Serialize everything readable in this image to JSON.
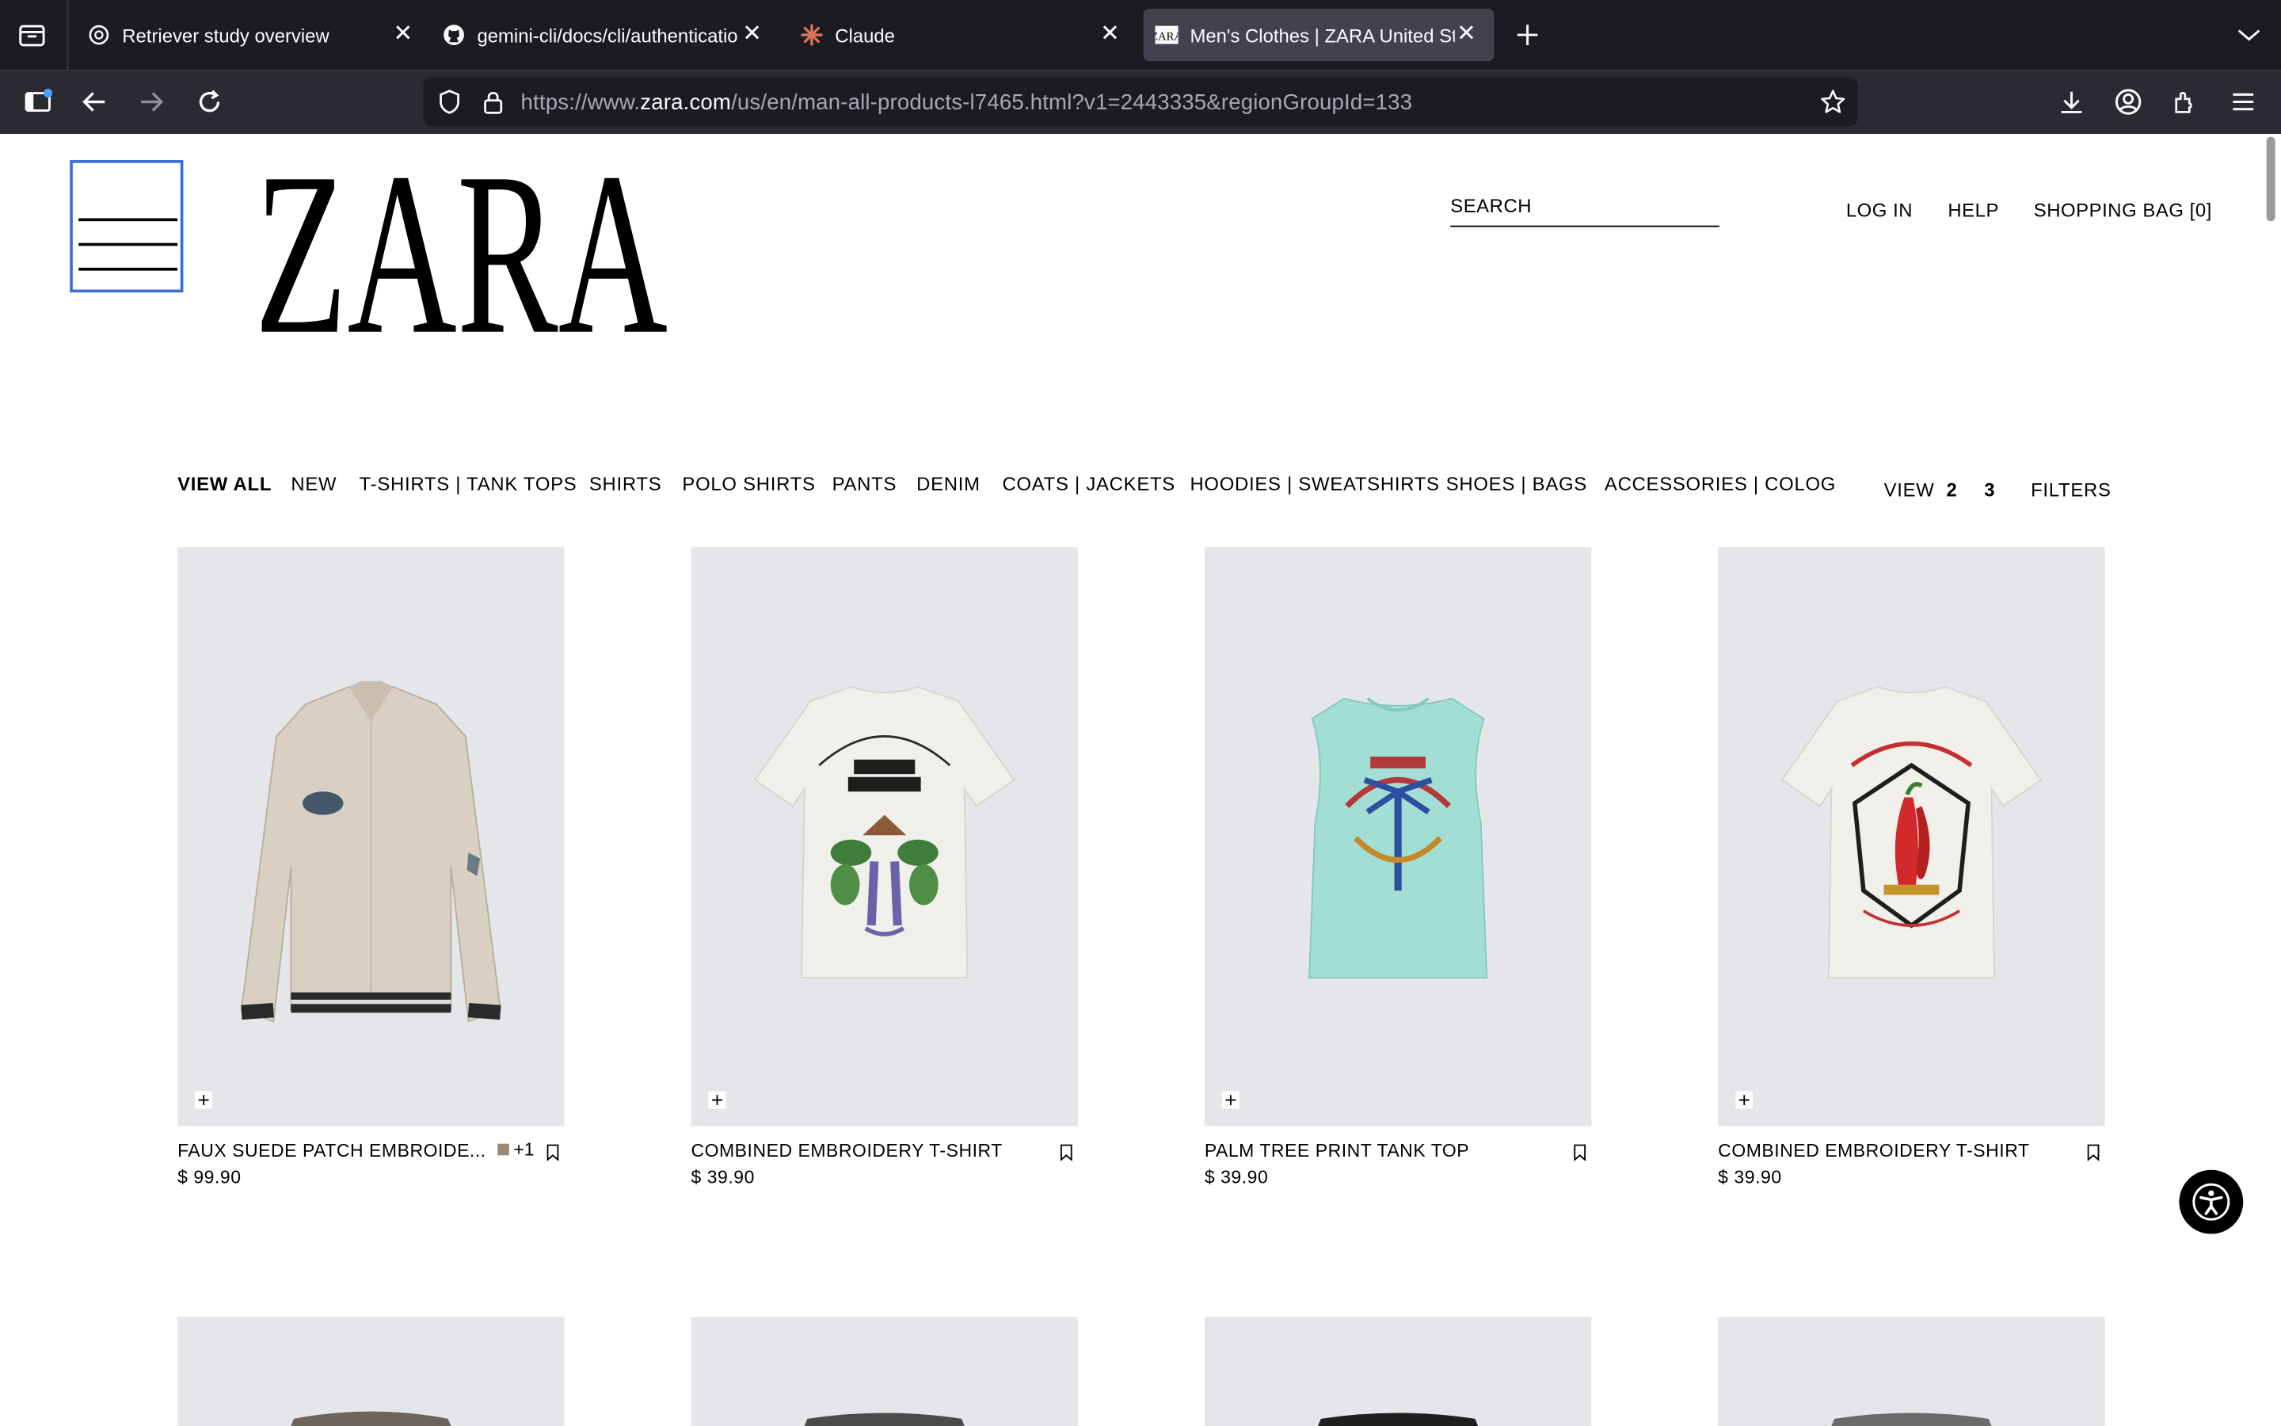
{
  "browser": {
    "tabs": [
      {
        "title": "Retriever study overview",
        "icon": "openai-icon"
      },
      {
        "title": "gemini-cli/docs/cli/authenticatio",
        "icon": "github-icon"
      },
      {
        "title": "Claude",
        "icon": "claude-icon"
      },
      {
        "title": "Men's Clothes | ZARA United St",
        "icon": "zara-favicon",
        "active": true
      }
    ],
    "url_prefix": "https://www.",
    "url_host": "zara.com",
    "url_path": "/us/en/man-all-products-l7465.html?v1=2443335&regionGroupId=133"
  },
  "header": {
    "logo": "ZARA",
    "search_label": "SEARCH",
    "login": "LOG IN",
    "help": "HELP",
    "bag": "SHOPPING BAG [0]"
  },
  "categories": [
    "VIEW ALL",
    "NEW",
    "T-SHIRTS | TANK TOPS",
    "SHIRTS",
    "POLO SHIRTS",
    "PANTS",
    "DENIM",
    "COATS | JACKETS",
    "HOODIES | SWEATSHIRTS",
    "SHOES | BAGS",
    "ACCESSORIES | COLOG"
  ],
  "view": {
    "label": "VIEW",
    "options": [
      "2",
      "3"
    ],
    "filters": "FILTERS"
  },
  "products": [
    {
      "name": "FAUX SUEDE PATCH EMBROIDE...",
      "price": "$ 99.90",
      "extra_colors": "+1",
      "swatch": "#9c8a78"
    },
    {
      "name": "COMBINED EMBROIDERY T-SHIRT",
      "price": "$ 39.90"
    },
    {
      "name": "PALM TREE PRINT TANK TOP",
      "price": "$ 39.90"
    },
    {
      "name": "COMBINED EMBROIDERY T-SHIRT",
      "price": "$ 39.90"
    }
  ],
  "colors": {
    "tabbar": "#1c1b22",
    "toolbar": "#2b2a33",
    "product_bg": "#e4e6e9",
    "focus": "#3b6fd6"
  }
}
